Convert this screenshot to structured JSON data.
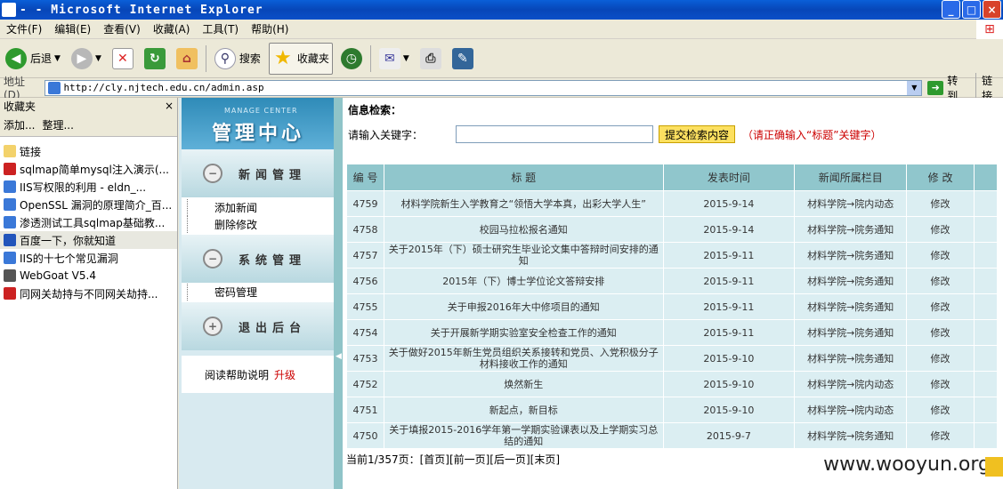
{
  "window": {
    "title": "- - Microsoft Internet Explorer",
    "buttons": [
      "_",
      "□",
      "×"
    ]
  },
  "menu": [
    "文件(F)",
    "编辑(E)",
    "查看(V)",
    "收藏(A)",
    "工具(T)",
    "帮助(H)"
  ],
  "toolbar": {
    "back": "后退",
    "search": "搜索",
    "favorites": "收藏夹"
  },
  "address": {
    "label": "地址(D)",
    "url": "http://cly.njtech.edu.cn/admin.asp",
    "go": "转到",
    "links": "链接"
  },
  "favpanel": {
    "title": "收藏夹",
    "close": "×",
    "add": "添加...",
    "organize": "整理...",
    "items": [
      {
        "label": "链接",
        "icon": "folder-icon"
      },
      {
        "label": "sqlmap简单mysql注入演示(...",
        "icon": "shield-icon"
      },
      {
        "label": "IIS写权限的利用 - eldn_...",
        "icon": "page-icon"
      },
      {
        "label": "OpenSSL 漏洞的原理简介_百...",
        "icon": "page-icon"
      },
      {
        "label": "渗透测试工具sqlmap基础教...",
        "icon": "page-icon"
      },
      {
        "label": "百度一下，你就知道",
        "icon": "paw-icon"
      },
      {
        "label": "IIS的十七个常见漏洞",
        "icon": "page-icon"
      },
      {
        "label": "WebGoat V5.4",
        "icon": "webgoat-icon"
      },
      {
        "label": "同网关劫持与不同网关劫持...",
        "icon": "shield-icon"
      }
    ]
  },
  "adminnav": {
    "small_title": "MANAGE CENTER",
    "big_title": "管理中心",
    "sections": [
      {
        "title": "新闻管理",
        "icon": "−",
        "links": [
          "添加新闻",
          "删除修改"
        ]
      },
      {
        "title": "系统管理",
        "icon": "−",
        "links": [
          "密码管理"
        ]
      },
      {
        "title": "退出后台",
        "icon": "+",
        "links": []
      }
    ],
    "help": "阅读帮助说明",
    "upgrade": "升级"
  },
  "main": {
    "heading": "信息检索：",
    "keyword_label": "请输入关键字：",
    "submit": "提交检索内容",
    "hint": "（请正确输入“标题”关键字）",
    "columns": [
      "编 号",
      "标 题",
      "发表时间",
      "新闻所属栏目",
      "修 改"
    ],
    "rows": [
      [
        "4759",
        "材料学院新生入学教育之“领悟大学本真，出彩大学人生”",
        "2015-9-14",
        "材料学院→院内动态",
        "修改"
      ],
      [
        "4758",
        "校园马拉松报名通知",
        "2015-9-14",
        "材料学院→院务通知",
        "修改"
      ],
      [
        "4757",
        "关于2015年（下）硕士研究生毕业论文集中答辩时间安排的通知",
        "2015-9-11",
        "材料学院→院务通知",
        "修改"
      ],
      [
        "4756",
        "2015年（下）博士学位论文答辩安排",
        "2015-9-11",
        "材料学院→院务通知",
        "修改"
      ],
      [
        "4755",
        "关于申报2016年大中修项目的通知",
        "2015-9-11",
        "材料学院→院务通知",
        "修改"
      ],
      [
        "4754",
        "关于开展新学期实验室安全检查工作的通知",
        "2015-9-11",
        "材料学院→院务通知",
        "修改"
      ],
      [
        "4753",
        "关于做好2015年新生党员组织关系接转和党员、入党积极分子材料接收工作的通知",
        "2015-9-10",
        "材料学院→院务通知",
        "修改"
      ],
      [
        "4752",
        "焕然新生",
        "2015-9-10",
        "材料学院→院内动态",
        "修改"
      ],
      [
        "4751",
        "新起点，新目标",
        "2015-9-10",
        "材料学院→院内动态",
        "修改"
      ],
      [
        "4750",
        "关于填报2015-2016学年第一学期实验课表以及上学期实习总结的通知",
        "2015-9-7",
        "材料学院→院务通知",
        "修改"
      ]
    ],
    "pager": "当前1/357页：[首页][前一页][后一页][末页]"
  },
  "watermark": "www.wooyun.org"
}
